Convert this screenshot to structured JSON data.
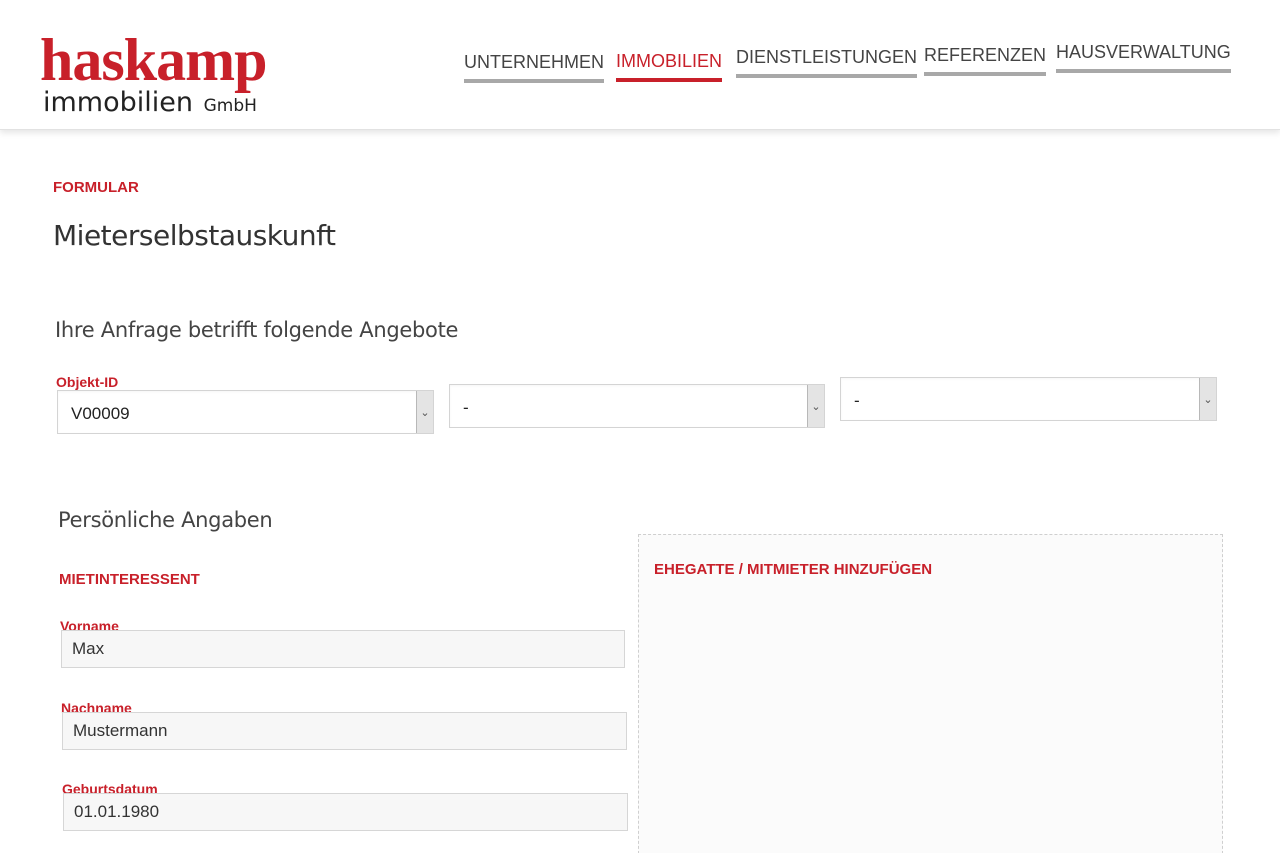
{
  "brand": {
    "name_main": "haskamp",
    "name_sub": "immobilien",
    "name_suffix": "GmbH"
  },
  "nav": {
    "items": [
      {
        "label": "UNTERNEHMEN",
        "active": false
      },
      {
        "label": "IMMOBILIEN",
        "active": true
      },
      {
        "label": "DIENSTLEISTUNGEN",
        "active": false
      },
      {
        "label": "REFERENZEN",
        "active": false
      },
      {
        "label": "HAUSVERWALTUNG",
        "active": false
      }
    ]
  },
  "page": {
    "category": "FORMULAR",
    "title": "Mieterselbstauskunft"
  },
  "offers": {
    "heading": "Ihre Anfrage betrifft folgende Angebote",
    "object_id_label": "Objekt-ID",
    "selects": [
      {
        "value": "V00009"
      },
      {
        "value": "-"
      },
      {
        "value": "-"
      }
    ]
  },
  "personal": {
    "heading": "Persönliche Angaben",
    "section_label": "MIETINTERESSENT",
    "fields": {
      "firstname": {
        "label": "Vorname",
        "value": "Max"
      },
      "lastname": {
        "label": "Nachname",
        "value": "Mustermann"
      },
      "birthdate": {
        "label": "Geburtsdatum",
        "value": "01.01.1980"
      }
    }
  },
  "co_tenant": {
    "title": "EHEGATTE / MITMIETER HINZUFÜGEN"
  },
  "colors": {
    "accent": "#c8202a",
    "nav_underline": "#a8a8a8",
    "input_bg": "#f7f7f7"
  },
  "icons": {
    "select_arrow": "chevron-down-icon"
  }
}
